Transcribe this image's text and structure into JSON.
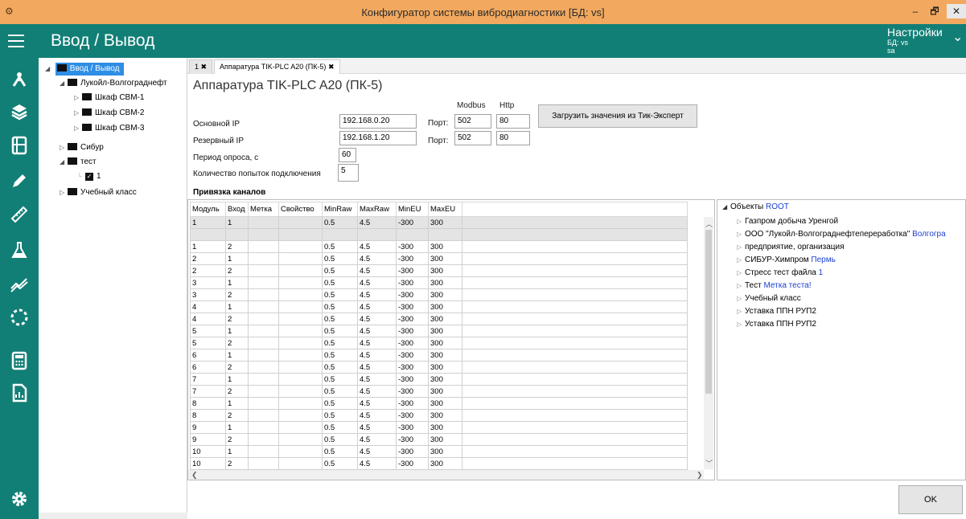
{
  "window": {
    "title": "Конфигуратор системы вибродиагностики [БД: vs]",
    "minimize": "–",
    "maximize": "🗗",
    "close": "✕"
  },
  "header": {
    "page_title": "Ввод / Вывод",
    "settings_label": "Настройки",
    "db_label": "БД: vs",
    "user_label": "sa"
  },
  "sidebar": {
    "icons": [
      "hierarchy-icon",
      "layers-icon",
      "cabinet-icon",
      "pencil-icon",
      "ruler-icon",
      "flask-icon",
      "trend-icon",
      "dashed-circle-icon",
      "calculator-icon",
      "report-icon"
    ],
    "settings_icon": "gear-icon"
  },
  "tree": {
    "root": "Ввод / Вывод",
    "lukoil": "Лукойл-Волгограднефт",
    "shkaf1": "Шкаф СВМ-1",
    "shkaf2": "Шкаф СВМ-2",
    "shkaf3": "Шкаф СВМ-3",
    "sibur": "Сибур",
    "test": "тест",
    "test_child": "1",
    "uchebny": "Учебный класс"
  },
  "tabs": [
    {
      "label": "1",
      "close": "✖"
    },
    {
      "label": "Аппаратура TIK-PLC A20 (ПК-5)",
      "close": "✖"
    }
  ],
  "device": {
    "title": "Аппаратура TIK-PLC A20 (ПК-5)",
    "col_modbus": "Modbus",
    "col_http": "Http",
    "main_ip_label": "Основной IP",
    "main_ip": "192.168.0.20",
    "port_label": "Порт:",
    "main_modbus": "502",
    "main_http": "80",
    "reserve_ip_label": "Резервный IP",
    "reserve_ip": "192.168.1.20",
    "reserve_modbus": "502",
    "reserve_http": "80",
    "poll_label": "Период опроса, с",
    "poll_value": "60",
    "attempts_label": "Количество попыток подключения",
    "attempts_value": "5",
    "load_button": "Загрузить значения из Тик-Эксперт",
    "binding_title": "Привязка каналов"
  },
  "grid": {
    "columns": [
      "Модуль",
      "Вход",
      "Метка",
      "Свойство",
      "MinRaw",
      "MaxRaw",
      "MinEU",
      "MaxEU"
    ],
    "rows": [
      [
        "1",
        "1",
        "",
        "",
        "0.5",
        "4.5",
        "-300",
        "300"
      ],
      [
        "",
        "",
        "",
        "",
        "",
        "",
        "",
        ""
      ],
      [
        "1",
        "2",
        "",
        "",
        "0.5",
        "4.5",
        "-300",
        "300"
      ],
      [
        "2",
        "1",
        "",
        "",
        "0.5",
        "4.5",
        "-300",
        "300"
      ],
      [
        "2",
        "2",
        "",
        "",
        "0.5",
        "4.5",
        "-300",
        "300"
      ],
      [
        "3",
        "1",
        "",
        "",
        "0.5",
        "4.5",
        "-300",
        "300"
      ],
      [
        "3",
        "2",
        "",
        "",
        "0.5",
        "4.5",
        "-300",
        "300"
      ],
      [
        "4",
        "1",
        "",
        "",
        "0.5",
        "4.5",
        "-300",
        "300"
      ],
      [
        "4",
        "2",
        "",
        "",
        "0.5",
        "4.5",
        "-300",
        "300"
      ],
      [
        "5",
        "1",
        "",
        "",
        "0.5",
        "4.5",
        "-300",
        "300"
      ],
      [
        "5",
        "2",
        "",
        "",
        "0.5",
        "4.5",
        "-300",
        "300"
      ],
      [
        "6",
        "1",
        "",
        "",
        "0.5",
        "4.5",
        "-300",
        "300"
      ],
      [
        "6",
        "2",
        "",
        "",
        "0.5",
        "4.5",
        "-300",
        "300"
      ],
      [
        "7",
        "1",
        "",
        "",
        "0.5",
        "4.5",
        "-300",
        "300"
      ],
      [
        "7",
        "2",
        "",
        "",
        "0.5",
        "4.5",
        "-300",
        "300"
      ],
      [
        "8",
        "1",
        "",
        "",
        "0.5",
        "4.5",
        "-300",
        "300"
      ],
      [
        "8",
        "2",
        "",
        "",
        "0.5",
        "4.5",
        "-300",
        "300"
      ],
      [
        "9",
        "1",
        "",
        "",
        "0.5",
        "4.5",
        "-300",
        "300"
      ],
      [
        "9",
        "2",
        "",
        "",
        "0.5",
        "4.5",
        "-300",
        "300"
      ],
      [
        "10",
        "1",
        "",
        "",
        "0.5",
        "4.5",
        "-300",
        "300"
      ],
      [
        "10",
        "2",
        "",
        "",
        "0.5",
        "4.5",
        "-300",
        "300"
      ]
    ]
  },
  "objects": {
    "root_label": "Объекты",
    "root_extra": "ROOT",
    "items": [
      {
        "label": "Газпром добыча Уренгой",
        "extra": ""
      },
      {
        "label": "ООО \"Лукойл-Волгограднефтепереработка\"",
        "extra": "Волгогра"
      },
      {
        "label": "предприятие, организация",
        "extra": ""
      },
      {
        "label": "СИБУР-Химпром",
        "extra": "Пермь"
      },
      {
        "label": "Стресс тест файла",
        "extra": "1"
      },
      {
        "label": "Тест",
        "extra": "Метка теста!"
      },
      {
        "label": "Учебный класс",
        "extra": ""
      },
      {
        "label": "Уставка ППН РУП2",
        "extra": ""
      },
      {
        "label": "Уставка ППН РУП2",
        "extra": ""
      }
    ]
  },
  "footer": {
    "ok_button": "OK"
  },
  "colors": {
    "accent": "#127f76",
    "titlebar": "#f2a95f",
    "selection": "#2e8ee5",
    "link": "#1c3fd1"
  }
}
